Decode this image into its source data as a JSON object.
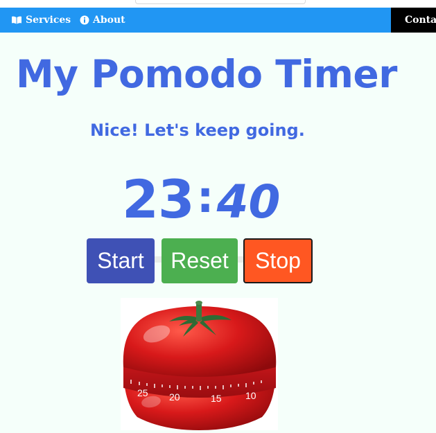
{
  "navbar": {
    "items": [
      {
        "label": "Services",
        "icon": "book-icon"
      },
      {
        "label": "About",
        "icon": "info-icon"
      },
      {
        "label": "Conta",
        "icon": "envelope-icon"
      }
    ]
  },
  "page": {
    "title": "My Pomodo Timer",
    "message": "Nice! Let's keep going."
  },
  "timer": {
    "minutes": "23",
    "separator": ":",
    "seconds": "40"
  },
  "controls": {
    "start_label": "Start",
    "reset_label": "Reset",
    "stop_label": "Stop"
  },
  "image": {
    "dial_numbers": [
      "25",
      "20",
      "15",
      "10"
    ]
  },
  "colors": {
    "navbar": "#2196f3",
    "contact_bg": "#000000",
    "text_accent": "#4169e1",
    "start": "#3f51b5",
    "reset": "#4caf50",
    "stop": "#ff5722",
    "background": "#f5fffa"
  }
}
